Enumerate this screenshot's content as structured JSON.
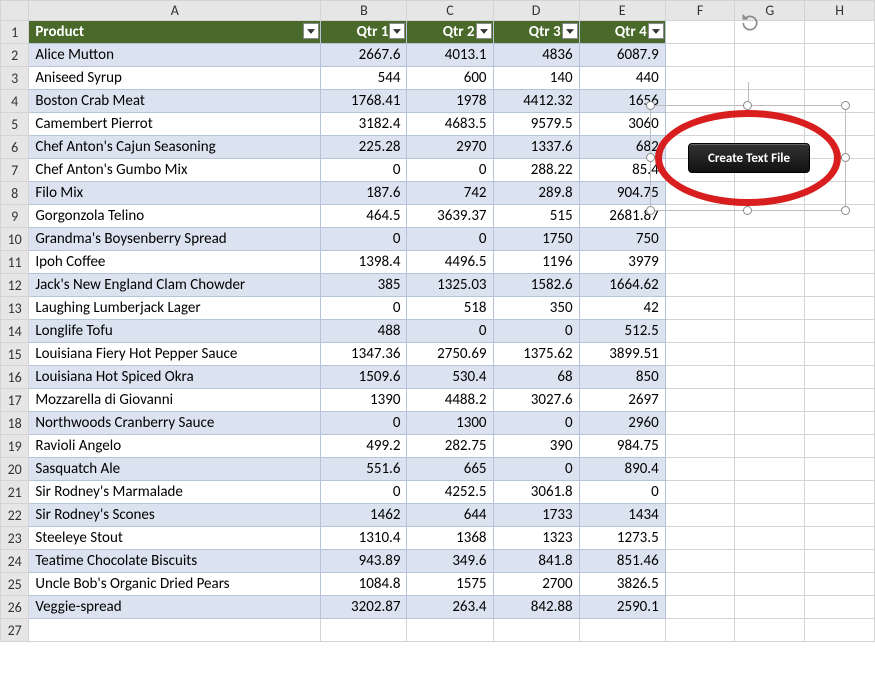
{
  "columns": [
    "A",
    "B",
    "C",
    "D",
    "E",
    "F",
    "G",
    "H"
  ],
  "header_row": 1,
  "table": {
    "headers": [
      "Product",
      "Qtr 1",
      "Qtr 2",
      "Qtr 3",
      "Qtr 4"
    ],
    "rows": [
      {
        "n": 2,
        "p": "Alice Mutton",
        "v": [
          "2667.6",
          "4013.1",
          "4836",
          "6087.9"
        ]
      },
      {
        "n": 3,
        "p": "Aniseed Syrup",
        "v": [
          "544",
          "600",
          "140",
          "440"
        ]
      },
      {
        "n": 4,
        "p": "Boston Crab Meat",
        "v": [
          "1768.41",
          "1978",
          "4412.32",
          "1656"
        ]
      },
      {
        "n": 5,
        "p": "Camembert Pierrot",
        "v": [
          "3182.4",
          "4683.5",
          "9579.5",
          "3060"
        ]
      },
      {
        "n": 6,
        "p": "Chef Anton's Cajun Seasoning",
        "v": [
          "225.28",
          "2970",
          "1337.6",
          "682"
        ]
      },
      {
        "n": 7,
        "p": "Chef Anton's Gumbo Mix",
        "v": [
          "0",
          "0",
          "288.22",
          "85.4"
        ]
      },
      {
        "n": 8,
        "p": "Filo Mix",
        "v": [
          "187.6",
          "742",
          "289.8",
          "904.75"
        ]
      },
      {
        "n": 9,
        "p": "Gorgonzola Telino",
        "v": [
          "464.5",
          "3639.37",
          "515",
          "2681.87"
        ]
      },
      {
        "n": 10,
        "p": "Grandma's Boysenberry Spread",
        "v": [
          "0",
          "0",
          "1750",
          "750"
        ]
      },
      {
        "n": 11,
        "p": "Ipoh Coffee",
        "v": [
          "1398.4",
          "4496.5",
          "1196",
          "3979"
        ]
      },
      {
        "n": 12,
        "p": "Jack's New England Clam Chowder",
        "v": [
          "385",
          "1325.03",
          "1582.6",
          "1664.62"
        ]
      },
      {
        "n": 13,
        "p": "Laughing Lumberjack Lager",
        "v": [
          "0",
          "518",
          "350",
          "42"
        ]
      },
      {
        "n": 14,
        "p": "Longlife Tofu",
        "v": [
          "488",
          "0",
          "0",
          "512.5"
        ]
      },
      {
        "n": 15,
        "p": "Louisiana Fiery Hot Pepper Sauce",
        "v": [
          "1347.36",
          "2750.69",
          "1375.62",
          "3899.51"
        ]
      },
      {
        "n": 16,
        "p": "Louisiana Hot Spiced Okra",
        "v": [
          "1509.6",
          "530.4",
          "68",
          "850"
        ]
      },
      {
        "n": 17,
        "p": "Mozzarella di Giovanni",
        "v": [
          "1390",
          "4488.2",
          "3027.6",
          "2697"
        ]
      },
      {
        "n": 18,
        "p": "Northwoods Cranberry Sauce",
        "v": [
          "0",
          "1300",
          "0",
          "2960"
        ]
      },
      {
        "n": 19,
        "p": "Ravioli Angelo",
        "v": [
          "499.2",
          "282.75",
          "390",
          "984.75"
        ]
      },
      {
        "n": 20,
        "p": "Sasquatch Ale",
        "v": [
          "551.6",
          "665",
          "0",
          "890.4"
        ]
      },
      {
        "n": 21,
        "p": "Sir Rodney's Marmalade",
        "v": [
          "0",
          "4252.5",
          "3061.8",
          "0"
        ]
      },
      {
        "n": 22,
        "p": "Sir Rodney's Scones",
        "v": [
          "1462",
          "644",
          "1733",
          "1434"
        ]
      },
      {
        "n": 23,
        "p": "Steeleye Stout",
        "v": [
          "1310.4",
          "1368",
          "1323",
          "1273.5"
        ]
      },
      {
        "n": 24,
        "p": "Teatime Chocolate Biscuits",
        "v": [
          "943.89",
          "349.6",
          "841.8",
          "851.46"
        ]
      },
      {
        "n": 25,
        "p": "Uncle Bob's Organic Dried Pears",
        "v": [
          "1084.8",
          "1575",
          "2700",
          "3826.5"
        ]
      },
      {
        "n": 26,
        "p": "Veggie-spread",
        "v": [
          "3202.87",
          "263.4",
          "842.88",
          "2590.1"
        ]
      }
    ],
    "trailing_rows": [
      27
    ]
  },
  "shape": {
    "button_label": "Create Text File"
  }
}
